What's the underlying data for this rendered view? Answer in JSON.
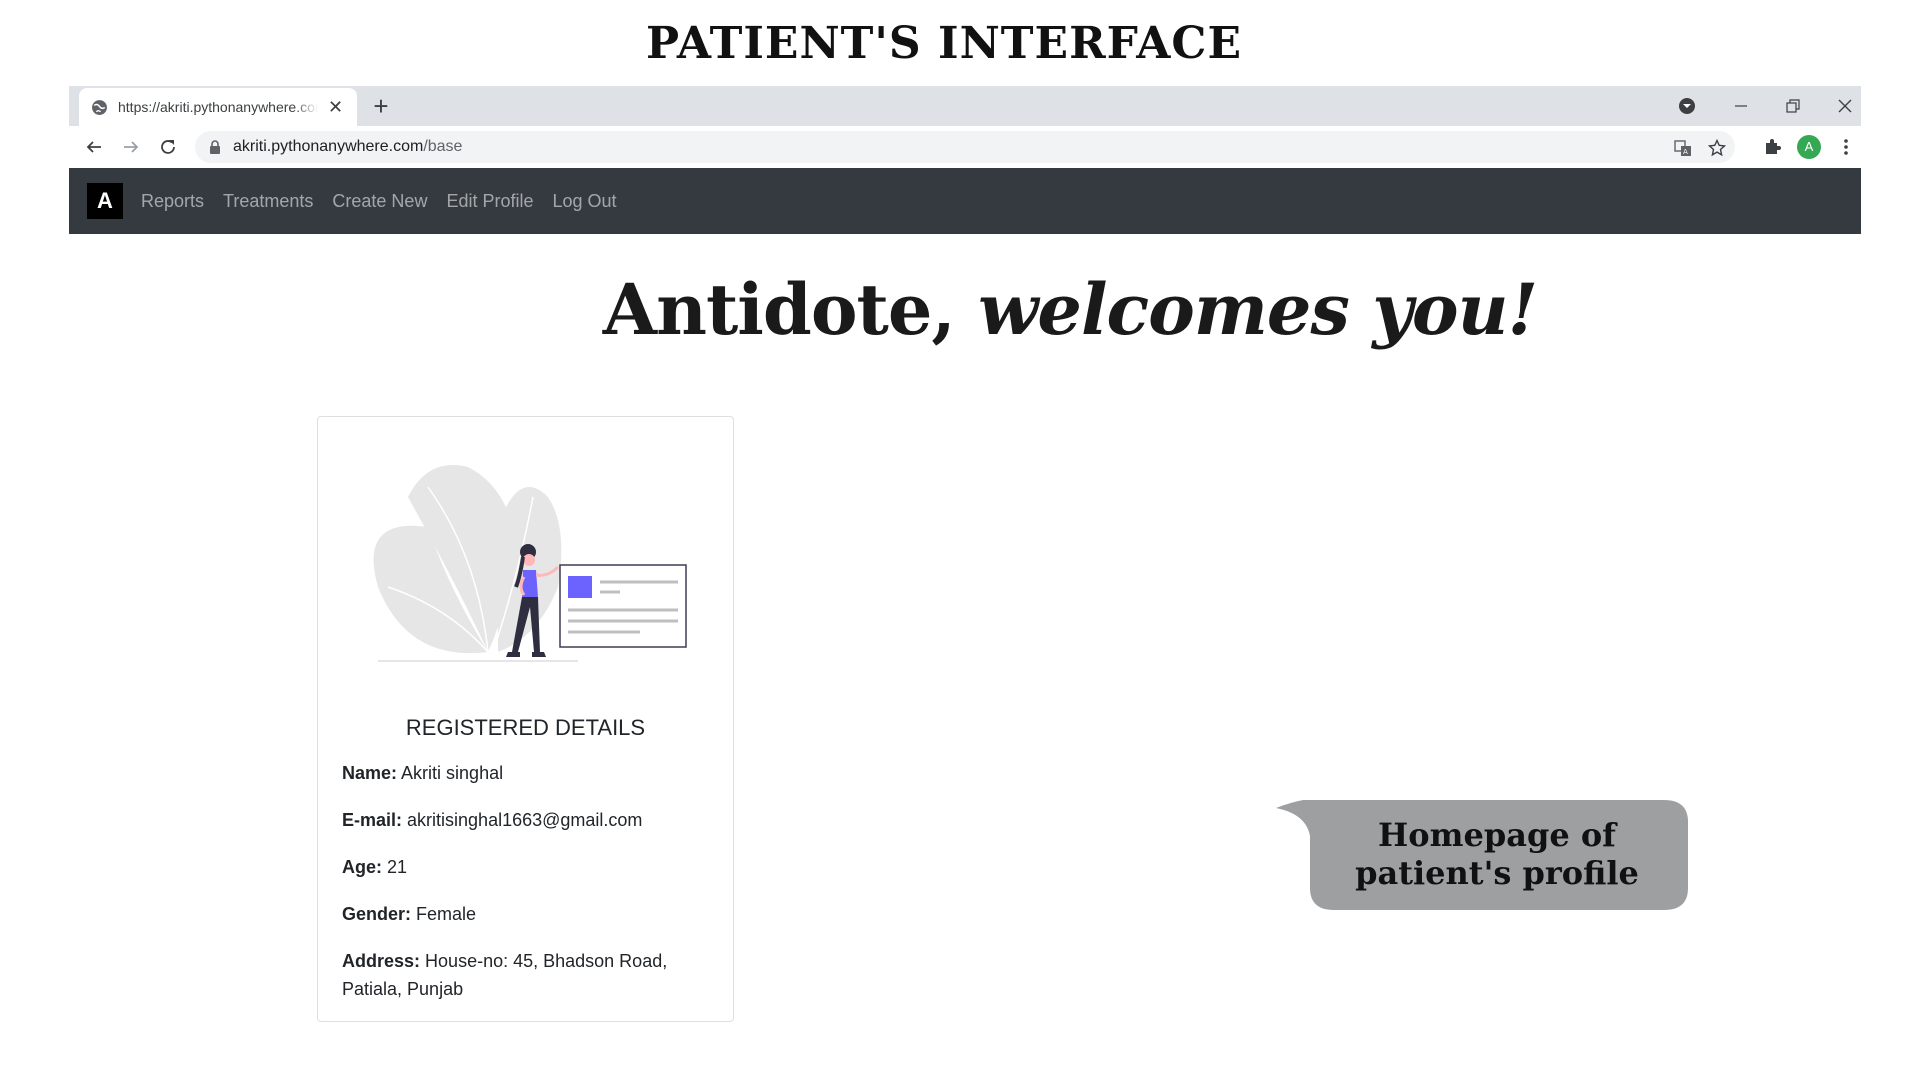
{
  "slide": {
    "title": "PATIENT'S INTERFACE"
  },
  "browser": {
    "tab_title": "https://akriti.pythonanywhere.com",
    "url_host": "akriti.pythonanywhere.com",
    "url_path": "/base",
    "profile_initial": "A"
  },
  "navbar": {
    "brand": "A",
    "links": [
      "Reports",
      "Treatments",
      "Create New",
      "Edit Profile",
      "Log Out"
    ]
  },
  "hero": {
    "text_main": "Antidote, ",
    "text_italic": "welcomes you!"
  },
  "card": {
    "heading": "REGISTERED DETAILS",
    "details": [
      {
        "label": "Name:",
        "value": "Akriti singhal"
      },
      {
        "label": "E-mail:",
        "value": "akritisinghal1663@gmail.com"
      },
      {
        "label": "Age:",
        "value": "21"
      },
      {
        "label": "Gender:",
        "value": "Female"
      },
      {
        "label": "Address:",
        "value": "House-no: 45, Bhadson Road, Patiala, Punjab"
      }
    ]
  },
  "callout": {
    "line1": "Homepage of",
    "line2": "patient's profile"
  },
  "colors": {
    "navbar_bg": "#343a40",
    "accent_purple": "#6c63ff",
    "callout_bg": "#9e9fa1"
  }
}
